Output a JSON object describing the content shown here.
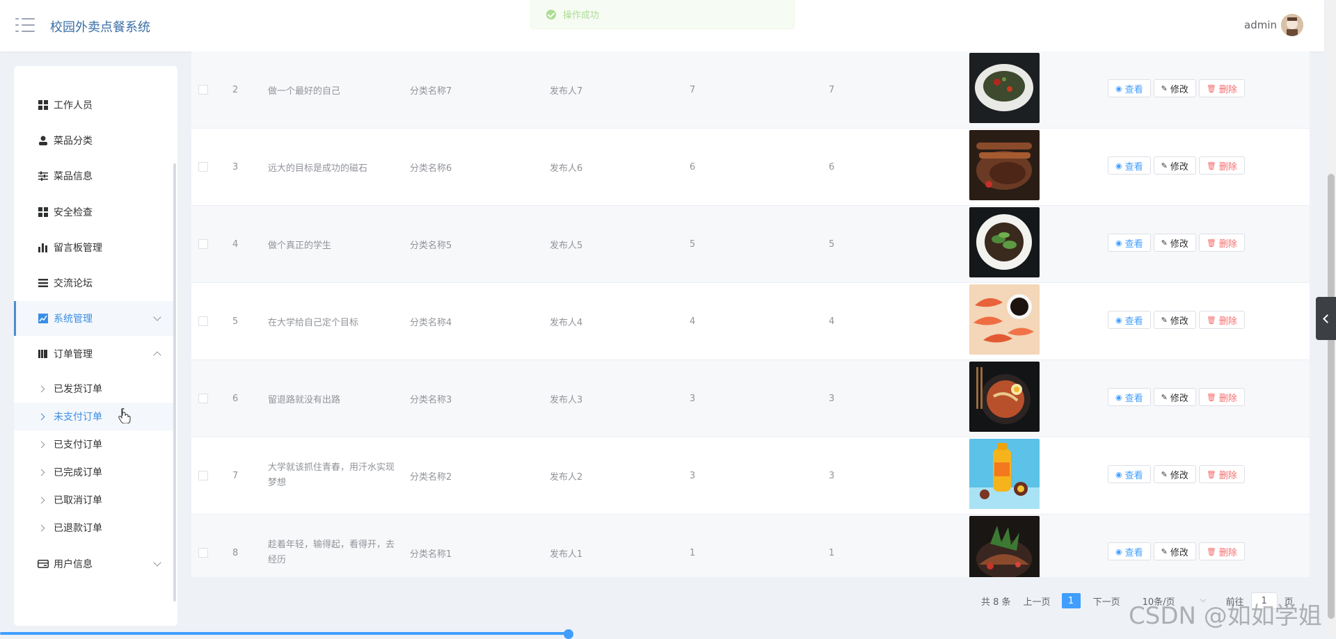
{
  "header": {
    "title": "校园外卖点餐系统",
    "user": "admin",
    "toast": "操作成功"
  },
  "sidebar": {
    "items": [
      {
        "label": "工作人员",
        "icon": "grid-icon"
      },
      {
        "label": "菜品分类",
        "icon": "person-icon"
      },
      {
        "label": "菜品信息",
        "icon": "sliders-icon"
      },
      {
        "label": "安全检查",
        "icon": "grid-icon"
      },
      {
        "label": "留言板管理",
        "icon": "bar-chart-icon"
      },
      {
        "label": "交流论坛",
        "icon": "list-icon"
      },
      {
        "label": "系统管理",
        "icon": "trend-chart-icon"
      },
      {
        "label": "订单管理",
        "icon": "books-icon"
      }
    ],
    "order_sub": [
      "已发货订单",
      "未支付订单",
      "已支付订单",
      "已完成订单",
      "已取消订单",
      "已退款订单"
    ],
    "user_info": "用户信息"
  },
  "table": {
    "actions": {
      "view": "查看",
      "edit": "修改",
      "delete": "删除"
    },
    "rows": [
      {
        "idx": "2",
        "title": "做一个最好的自己",
        "category": "分类名称7",
        "publisher": "发布人7",
        "a": "7",
        "b": "7"
      },
      {
        "idx": "3",
        "title": "远大的目标是成功的磁石",
        "category": "分类名称6",
        "publisher": "发布人6",
        "a": "6",
        "b": "6"
      },
      {
        "idx": "4",
        "title": "做个真正的学生",
        "category": "分类名称5",
        "publisher": "发布人5",
        "a": "5",
        "b": "5"
      },
      {
        "idx": "5",
        "title": "在大学给自己定个目标",
        "category": "分类名称4",
        "publisher": "发布人4",
        "a": "4",
        "b": "4"
      },
      {
        "idx": "6",
        "title": "留退路就没有出路",
        "category": "分类名称3",
        "publisher": "发布人3",
        "a": "3",
        "b": "3"
      },
      {
        "idx": "7",
        "title": "大学就该抓住青春，用汗水实现梦想",
        "category": "分类名称2",
        "publisher": "发布人2",
        "a": "3",
        "b": "3"
      },
      {
        "idx": "8",
        "title": "趁着年轻，输得起，看得开，去经历",
        "category": "分类名称1",
        "publisher": "发布人1",
        "a": "1",
        "b": "1"
      }
    ]
  },
  "pagination": {
    "total": "共 8 条",
    "prev": "上一页",
    "current": "1",
    "next": "下一页",
    "page_size": "10条/页",
    "goto": "前往",
    "goto_value": "1",
    "page_unit": "页"
  },
  "watermark": "CSDN @如如学姐"
}
